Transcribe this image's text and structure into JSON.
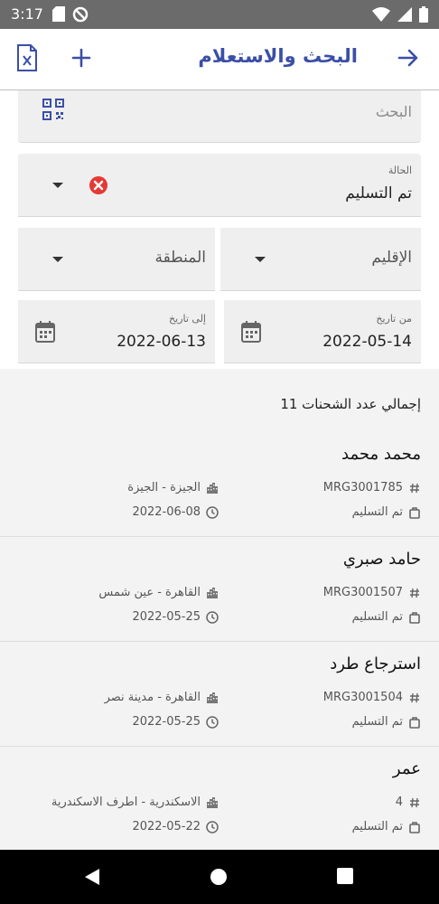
{
  "status_bar": {
    "time": "3:17",
    "icons_left": [
      "sd-card-icon",
      "blocked-icon"
    ],
    "icons_right": [
      "wifi-icon",
      "signal-icon",
      "battery-icon"
    ]
  },
  "app_bar": {
    "title": "البحث والاستعلام",
    "back_icon": "arrow-right-icon",
    "add_icon": "plus-icon",
    "export_icon": "excel-file-icon",
    "accent_color": "#3b4fa6"
  },
  "filters": {
    "search_placeholder": "البحث",
    "status_label": "الحالة",
    "status_value": "تم التسليم",
    "region_placeholder": "الإقليم",
    "area_placeholder": "المنطقة",
    "from_label": "من تاريخ",
    "from_value": "2022-05-14",
    "to_label": "إلى تاريخ",
    "to_value": "2022-06-13"
  },
  "summary": {
    "total_text": "إجمالي عدد الشحنات 11"
  },
  "shipments": [
    {
      "name": "محمد محمد",
      "code": "MRG3001785",
      "state": "تم التسليم",
      "location": "الجيزة - الجيزة",
      "date": "2022-06-08"
    },
    {
      "name": "حامد صبري",
      "code": "MRG3001507",
      "state": "تم التسليم",
      "location": "القاهرة - عين شمس",
      "date": "2022-05-25"
    },
    {
      "name": "استرجاع طرد",
      "code": "MRG3001504",
      "state": "تم التسليم",
      "location": "القاهرة - مدينة نصر",
      "date": "2022-05-25"
    },
    {
      "name": "عمر",
      "code": "4",
      "state": "تم التسليم",
      "location": "الاسكندرية - اطرف الاسكندرية",
      "date": "2022-05-22"
    }
  ]
}
